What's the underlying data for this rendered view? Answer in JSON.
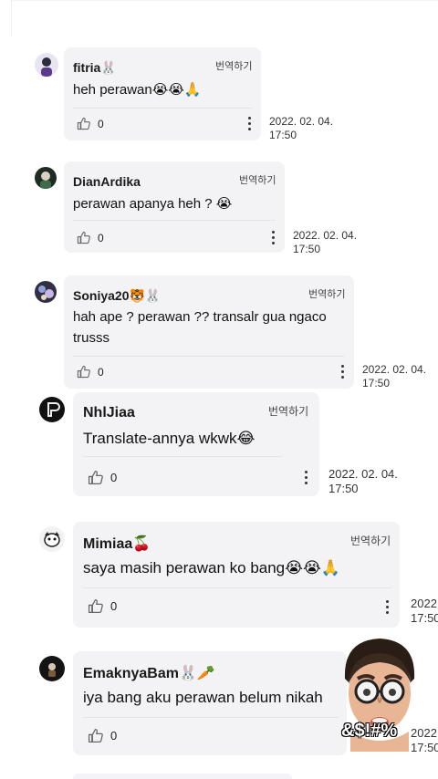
{
  "comments": [
    {
      "user": "fitria",
      "name_emoji": "🐰",
      "text": "heh perawan😭😭🙏",
      "translate": "번역하기",
      "likes": "0",
      "date": "2022. 02. 04.",
      "time": "17:50"
    },
    {
      "user": "DianArdika",
      "name_emoji": "",
      "text": "perawan apanya heh ? 😭",
      "translate": "번역하기",
      "likes": "0",
      "date": "2022. 02. 04.",
      "time": "17:50"
    },
    {
      "user": "Soniya20",
      "name_emoji": "🐯🐰",
      "text": "hah ape ? perawan ?? transalr gua ngaco trusss",
      "translate": "번역하기",
      "likes": "0",
      "date": "2022. 02. 04.",
      "time": "17:50"
    },
    {
      "user": "NhlJiaa",
      "name_emoji": "",
      "text": "Translate-annya wkwk😂",
      "translate": "번역하기",
      "likes": "0",
      "date": "2022. 02. 04.",
      "time": "17:50"
    },
    {
      "user": "Mimiaa",
      "name_emoji": "🍒",
      "text": "saya masih perawan ko bang😭😭🙏",
      "translate": "번역하기",
      "likes": "0",
      "date": "2022",
      "time": "17:50"
    },
    {
      "user": "EmaknyaBam",
      "name_emoji": "🐰🥕",
      "text": "iya bang aku perawan belum nikah",
      "translate": "",
      "likes": "0",
      "date": "2022",
      "time": "17:50"
    }
  ],
  "overlay": {
    "sticker_text": "&$!#%",
    "sticker_icon": "memoji-face-icon"
  },
  "colors": {
    "bubble": "#f3f3f6",
    "divider": "#e2e2e8",
    "text": "#111111"
  }
}
